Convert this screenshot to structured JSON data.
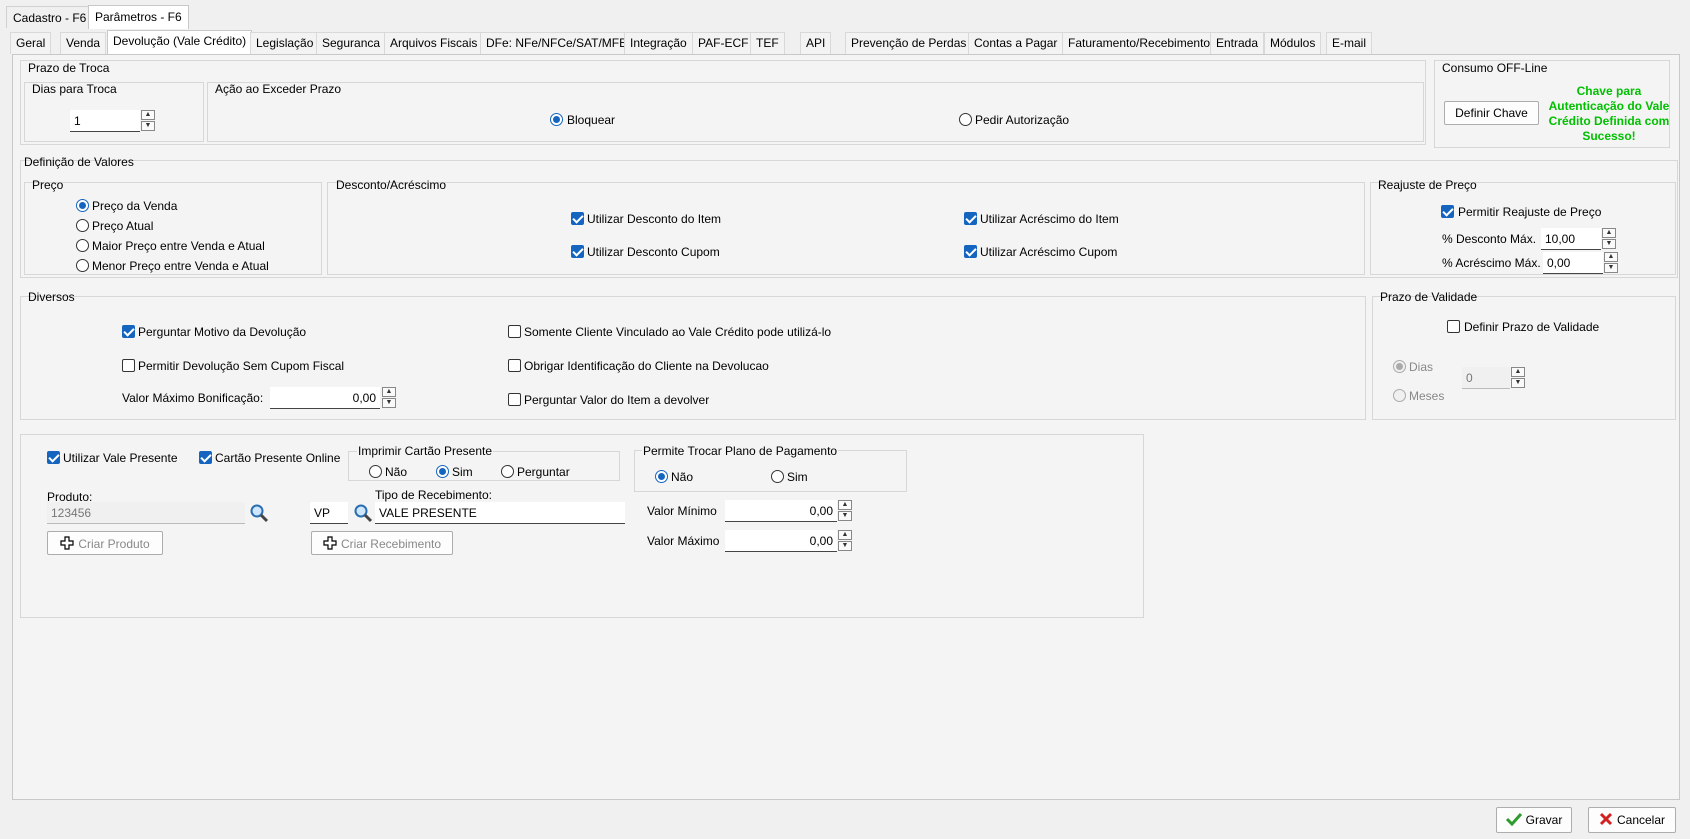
{
  "top_tabs": [
    {
      "label": "Cadastro - F6"
    },
    {
      "label": "Parâmetros - F6"
    }
  ],
  "tabs": [
    {
      "label": "Geral"
    },
    {
      "label": "Venda"
    },
    {
      "label": "Devolução (Vale Crédito)"
    },
    {
      "label": "Legislação"
    },
    {
      "label": "Seguranca"
    },
    {
      "label": "Arquivos Fiscais"
    },
    {
      "label": "DFe: NFe/NFCe/SAT/MFE"
    },
    {
      "label": "Integração"
    },
    {
      "label": "PAF-ECF"
    },
    {
      "label": "TEF"
    },
    {
      "label": "API"
    },
    {
      "label": "Prevenção de Perdas"
    },
    {
      "label": "Contas a Pagar"
    },
    {
      "label": "Faturamento/Recebimento"
    },
    {
      "label": "Entrada"
    },
    {
      "label": "Módulos"
    },
    {
      "label": "E-mail"
    }
  ],
  "prazo_troca": {
    "title": "Prazo de Troca",
    "dias_title": "Dias para Troca",
    "dias_value": "1",
    "acao_title": "Ação ao Exceder Prazo",
    "bloquear": "Bloquear",
    "pedir": "Pedir Autorização"
  },
  "consumo": {
    "title": "Consumo OFF-Line",
    "button": "Definir Chave",
    "status": "Chave para Autenticação do Vale Crédito Definida com Sucesso!",
    "status_color": "#00c000"
  },
  "definicao": {
    "title": "Definição de Valores",
    "preco": {
      "title": "Preço",
      "options": [
        "Preço da Venda",
        "Preço Atual",
        "Maior Preço entre Venda e Atual",
        "Menor Preço entre Venda e Atual"
      ]
    },
    "desconto": {
      "title": "Desconto/Acréscimo",
      "desc_item": "Utilizar Desconto do Item",
      "desc_cupom": "Utilizar Desconto Cupom",
      "acr_item": "Utilizar Acréscimo do Item",
      "acr_cupom": "Utilizar Acréscimo Cupom"
    },
    "reajuste": {
      "title": "Reajuste de Preço",
      "permitir": "Permitir Reajuste de Preço",
      "desc_label": "% Desconto Máx.",
      "desc_value": "10,00",
      "acr_label": "% Acréscimo Máx.",
      "acr_value": "0,00"
    }
  },
  "diversos": {
    "title": "Diversos",
    "motivo": "Perguntar Motivo da Devolução",
    "sem_cupom": "Permitir Devolução Sem Cupom Fiscal",
    "bonif_label": "Valor Máximo Bonificação:",
    "bonif_value": "0,00",
    "somente": "Somente Cliente Vinculado ao Vale Crédito pode utilizá-lo",
    "obrigar": "Obrigar Identificação do Cliente na Devolucao",
    "perguntar_valor": "Perguntar Valor do Item a devolver"
  },
  "validade": {
    "title": "Prazo de Validade",
    "definir": "Definir Prazo de Validade",
    "dias": "Dias",
    "meses": "Meses",
    "value": "0"
  },
  "vale_presente": {
    "utilizar": "Utilizar Vale Presente",
    "online": "Cartão Presente Online",
    "imprimir_title": "Imprimir Cartão Presente",
    "nao": "Não",
    "sim": "Sim",
    "perguntar": "Perguntar",
    "produto_label": "Produto:",
    "produto_value": "123456",
    "criar_produto": "Criar Produto",
    "tipo_label": "Tipo de Recebimento:",
    "tipo_code": "VP",
    "tipo_value": "VALE PRESENTE",
    "criar_receb": "Criar Recebimento",
    "plano_title": "Permite Trocar Plano de Pagamento",
    "plano_nao": "Não",
    "plano_sim": "Sim",
    "min_label": "Valor Mínimo",
    "min_value": "0,00",
    "max_label": "Valor Máximo",
    "max_value": "0,00"
  },
  "footer": {
    "gravar": "Gravar",
    "cancelar": "Cancelar"
  }
}
